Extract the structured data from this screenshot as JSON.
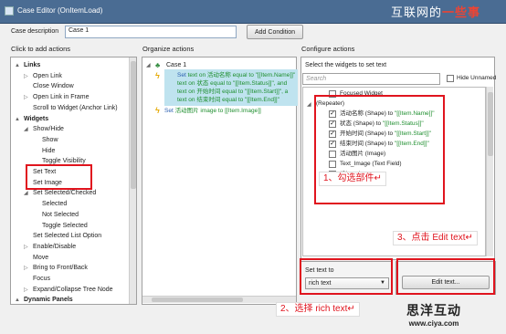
{
  "window": {
    "title": "Case Editor (OnItemLoad)"
  },
  "watermark_top": {
    "prefix": "互联网的",
    "accent": "一些事"
  },
  "case_description": {
    "label": "Case description",
    "value": "Case 1",
    "add_condition_label": "Add Condition"
  },
  "left_panel": {
    "header": "Click to add actions",
    "items": [
      {
        "label": "Links",
        "level": 0,
        "bold": true,
        "arrow": "▲"
      },
      {
        "label": "Open Link",
        "level": 1,
        "arrow": "▷"
      },
      {
        "label": "Close Window",
        "level": 1
      },
      {
        "label": "Open Link in Frame",
        "level": 1,
        "arrow": "▷"
      },
      {
        "label": "Scroll to Widget (Anchor Link)",
        "level": 1
      },
      {
        "label": "Widgets",
        "level": 0,
        "bold": true,
        "arrow": "▲"
      },
      {
        "label": "Show/Hide",
        "level": 1,
        "arrow": "◢"
      },
      {
        "label": "Show",
        "level": 2
      },
      {
        "label": "Hide",
        "level": 2
      },
      {
        "label": "Toggle Visibility",
        "level": 2
      },
      {
        "label": "Set Text",
        "level": 1
      },
      {
        "label": "Set Image",
        "level": 1
      },
      {
        "label": "Set Selected/Checked",
        "level": 1,
        "arrow": "◢"
      },
      {
        "label": "Selected",
        "level": 2
      },
      {
        "label": "Not Selected",
        "level": 2
      },
      {
        "label": "Toggle Selected",
        "level": 2
      },
      {
        "label": "Set Selected List Option",
        "level": 1
      },
      {
        "label": "Enable/Disable",
        "level": 1,
        "arrow": "▷"
      },
      {
        "label": "Move",
        "level": 1
      },
      {
        "label": "Bring to Front/Back",
        "level": 1,
        "arrow": "▷"
      },
      {
        "label": "Focus",
        "level": 1
      },
      {
        "label": "Expand/Collapse Tree Node",
        "level": 1,
        "arrow": "▷"
      },
      {
        "label": "Dynamic Panels",
        "level": 0,
        "bold": true,
        "arrow": "▲"
      }
    ]
  },
  "middle_panel": {
    "header": "Organize actions",
    "case_label": "Case 1",
    "action1": [
      {
        "a": "Set ",
        "b": "text on 活动名称 equal to \"[[Item.Name]]\""
      },
      {
        "a": "",
        "b": "text on 状态 equal to \"[[Item.Status]]\", and"
      },
      {
        "a": "",
        "b": "text on 开始时间 equal to \"[[Item.Start]]\", a"
      },
      {
        "a": "",
        "b": "text on 结束时间 equal to \"[[Item.End]]\""
      }
    ],
    "action2": {
      "a": "Set ",
      "b": "活动图片 image to [[Item.Image]]"
    }
  },
  "right_panel": {
    "header": "Configure actions",
    "select_label": "Select the widgets to set text",
    "search_placeholder": "Search",
    "hide_unnamed": "Hide Unnamed",
    "widgets": [
      {
        "label": "Focused Widget",
        "checkbox": true,
        "checked": false,
        "indent": 0
      },
      {
        "label": "(Repeater)",
        "checkbox": false,
        "indent": 0,
        "arrow": "◢"
      },
      {
        "name": "活动名称 (Shape) to ",
        "value": "\"[[Item.Name]]\"",
        "checkbox": true,
        "checked": true,
        "indent": 1
      },
      {
        "name": "状态 (Shape) to ",
        "value": "\"[[Item.Status]]\"",
        "checkbox": true,
        "checked": true,
        "indent": 1
      },
      {
        "name": "开始时间 (Shape) to ",
        "value": "\"[[Item.Start]]\"",
        "checkbox": true,
        "checked": true,
        "indent": 1
      },
      {
        "name": "结束时间 (Shape) to ",
        "value": "\"[[Item.End]]\"",
        "checkbox": true,
        "checked": true,
        "indent": 1
      },
      {
        "label": "活动图片 (Image)",
        "checkbox": true,
        "checked": false,
        "indent": 1
      },
      {
        "label": "Text_Image (Text Field)",
        "checkbox": true,
        "checked": false,
        "indent": 0
      },
      {
        "label": "(Shape)",
        "checkbox": true,
        "checked": false,
        "indent": 0
      }
    ],
    "set_text_to_label": "Set text to",
    "set_text_to_value": "rich text",
    "edit_text_label": "Edit text..."
  },
  "annotations": {
    "a1": "1、勾选部件↵",
    "a2": "2、选择 rich  text↵",
    "a3": "3、点击 Edit  text↵"
  },
  "watermark_bottom": {
    "title": "思洋互动",
    "url": "www.ciya.com"
  }
}
